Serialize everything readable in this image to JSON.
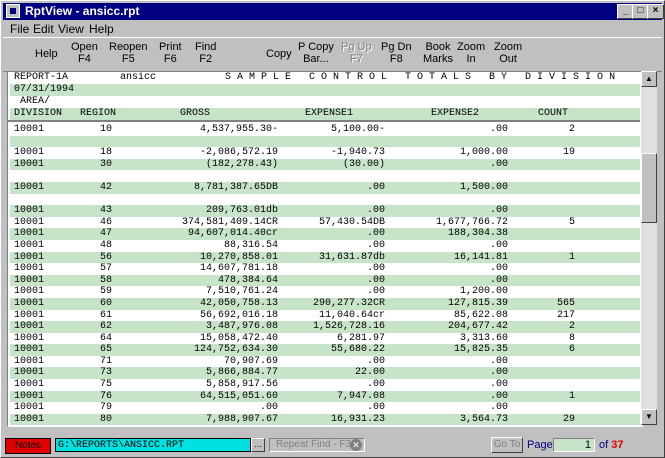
{
  "window": {
    "title": "RptView - ansicc.rpt"
  },
  "menu": [
    "File",
    "Edit",
    "View",
    "Help"
  ],
  "toolbar": [
    {
      "l1": "Help",
      "l2": "",
      "disabled": false
    },
    {
      "l1": "Open",
      "l2": "F4",
      "disabled": false
    },
    {
      "l1": "Reopen",
      "l2": "F5",
      "disabled": false
    },
    {
      "l1": "Print",
      "l2": "F6",
      "disabled": false
    },
    {
      "l1": "Find",
      "l2": "F2",
      "disabled": false
    },
    {
      "l1": "Copy",
      "l2": "",
      "disabled": false
    },
    {
      "l1": "P Copy",
      "l2": "Bar...",
      "disabled": false
    },
    {
      "l1": "Pg Up",
      "l2": "F7",
      "disabled": true
    },
    {
      "l1": "Pg Dn",
      "l2": "F8",
      "disabled": false
    },
    {
      "l1": "Book",
      "l2": "Marks",
      "disabled": false
    },
    {
      "l1": "Zoom",
      "l2": "In",
      "disabled": false
    },
    {
      "l1": "Zoom",
      "l2": "Out",
      "disabled": false
    }
  ],
  "report": {
    "id": "REPORT-1A",
    "file": "ansicc",
    "title": "S A M P L E   C O N T R O L   T O T A L S   B Y   D I V I S I O N",
    "date": "07/31/1994",
    "area": " AREA/",
    "columns": [
      "DIVISION",
      "REGION",
      "GROSS",
      "EXPENSE1",
      "EXPENSE2",
      "COUNT"
    ]
  },
  "rows": [
    [
      "10001",
      "10",
      "4,537,955.30-",
      "5,100.00-",
      ".00",
      "2"
    ],
    [
      "",
      "",
      "",
      "",
      "",
      ""
    ],
    [
      "10001",
      "18",
      "-2,086,572.19",
      "-1,940.73",
      "1,000.00",
      "19"
    ],
    [
      "10001",
      "30",
      "(182,278.43)",
      "(30.00)",
      ".00",
      ""
    ],
    [
      "",
      "",
      "",
      "",
      "",
      ""
    ],
    [
      "10001",
      "42",
      "8,781,387.65DB",
      ".00",
      "1,500.00",
      ""
    ],
    [
      "",
      "",
      "",
      "",
      "",
      ""
    ],
    [
      "10001",
      "43",
      "209,763.01db",
      ".00",
      ".00",
      ""
    ],
    [
      "10001",
      "46",
      "374,581,409.14CR",
      "57,430.54DB",
      "1,677,766.72",
      "5"
    ],
    [
      "10001",
      "47",
      "94,607,014.40cr",
      ".00",
      "188,304.38",
      ""
    ],
    [
      "10001",
      "48",
      "88,316.54",
      ".00",
      ".00",
      ""
    ],
    [
      "10001",
      "56",
      "10,270,858.01",
      "31,631.87db",
      "16,141.81",
      "1"
    ],
    [
      "10001",
      "57",
      "14,607,781.18",
      ".00",
      ".00",
      ""
    ],
    [
      "10001",
      "58",
      "478,384.64",
      ".00",
      ".00",
      ""
    ],
    [
      "10001",
      "59",
      "7,510,761.24",
      ".00",
      "1,200.00",
      ""
    ],
    [
      "10001",
      "60",
      "42,050,758.13",
      "290,277.32CR",
      "127,815.39",
      "565"
    ],
    [
      "10001",
      "61",
      "56,692,016.18",
      "11,040.64cr",
      "85,622.08",
      "217"
    ],
    [
      "10001",
      "62",
      "3,487,976.08",
      "1,526,728.16",
      "204,677.42",
      "2"
    ],
    [
      "10001",
      "64",
      "15,058,472.40",
      "6,281.97",
      "3,313.60",
      "8"
    ],
    [
      "10001",
      "65",
      "124,752,634.30",
      "55,680.22",
      "15,825.35",
      "6"
    ],
    [
      "10001",
      "71",
      "70,907.69",
      ".00",
      ".00",
      ""
    ],
    [
      "10001",
      "73",
      "5,866,884.77",
      "22.00",
      ".00",
      ""
    ],
    [
      "10001",
      "75",
      "5,858,917.56",
      ".00",
      ".00",
      ""
    ],
    [
      "10001",
      "76",
      "64,515,051.60",
      "7,947.08",
      ".00",
      "1"
    ],
    [
      "10001",
      "79",
      ".00",
      ".00",
      ".00",
      ""
    ],
    [
      "10001",
      "80",
      "7,988,907.67",
      "16,931.23",
      "3,564.73",
      "29"
    ]
  ],
  "status": {
    "notes": "Notes",
    "path": "G:\\REPORTS\\ANSICC.RPT",
    "browse": "...",
    "repeat_find": "Repeat Find - F3",
    "goto": "Go To",
    "page_label": "Page",
    "page": "1",
    "of": "of",
    "total_pages": "37"
  }
}
